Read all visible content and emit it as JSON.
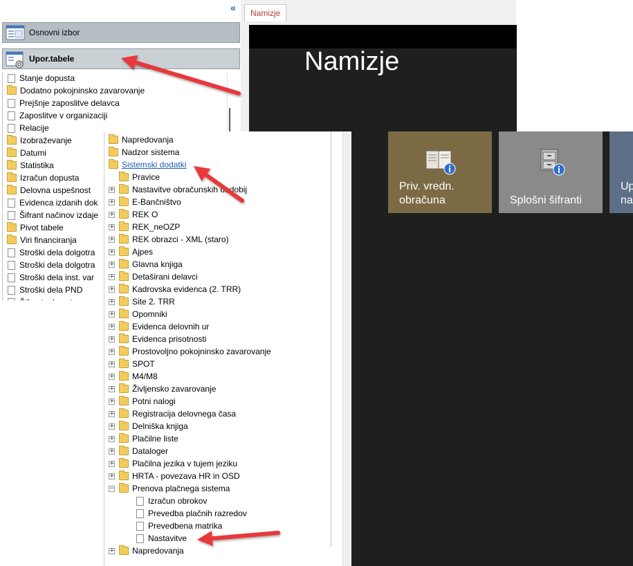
{
  "sidebar": {
    "collapse_glyph": "«",
    "panel_main": "Osnovni izbor",
    "panel_tables": "Upor.tabele",
    "items": [
      {
        "label": "Stanje dopusta",
        "icon": "document-icon"
      },
      {
        "label": "Dodatno pokojninsko zavarovanje",
        "icon": "folder-icon"
      },
      {
        "label": "Prejšnje zaposlitve delavca",
        "icon": "document-icon"
      },
      {
        "label": "Zaposlitve v organizaciji",
        "icon": "document-icon"
      },
      {
        "label": "Relacije",
        "icon": "document-icon"
      },
      {
        "label": "Izobraževanje",
        "icon": "folder-icon"
      },
      {
        "label": "Datumi",
        "icon": "folder-icon"
      },
      {
        "label": "Statistika",
        "icon": "folder-icon"
      },
      {
        "label": "Izračun dopusta",
        "icon": "folder-icon"
      },
      {
        "label": "Delovna uspešnost",
        "icon": "folder-icon"
      },
      {
        "label": "Evidenca izdanih dok",
        "icon": "document-icon"
      },
      {
        "label": "Šifrant načinov izdaje",
        "icon": "document-icon"
      },
      {
        "label": "Pivot tabele",
        "icon": "folder-icon"
      },
      {
        "label": "Viri financiranja",
        "icon": "folder-icon"
      },
      {
        "label": "Stroški dela dolgotra",
        "icon": "document-icon"
      },
      {
        "label": "Stroški dela dolgotra",
        "icon": "document-icon"
      },
      {
        "label": "Stroški dela inst. var",
        "icon": "document-icon"
      },
      {
        "label": "Stroški dela PND",
        "icon": "document-icon"
      },
      {
        "label": "Šifrant zdravstv",
        "icon": "document-icon"
      }
    ]
  },
  "desktop": {
    "tab_label": "Namizje",
    "title": "Namizje",
    "tiles": [
      {
        "label_line1": "Priv. vredn.",
        "label_line2": "obračuna",
        "color": "#7b6a43",
        "icon": "book-info-icon"
      },
      {
        "label_line1": "Splošni šifranti",
        "label_line2": "",
        "color": "#8a8a8a",
        "icon": "cabinet-info-icon"
      },
      {
        "label_line1": "Up",
        "label_line2": "na",
        "color": "#5d6f86",
        "icon": ""
      }
    ]
  },
  "tree": {
    "rows": [
      {
        "label": "Napredovanja",
        "type": "folder",
        "expander": "",
        "level": 0,
        "style": "normal"
      },
      {
        "label": "Nadzor sistema",
        "type": "folder",
        "expander": "",
        "level": 0,
        "style": "normal"
      },
      {
        "label": "Sistemski dodatki",
        "type": "folder",
        "expander": "",
        "level": 0,
        "style": "link"
      },
      {
        "label": "Pravice",
        "type": "folder",
        "expander": "",
        "level": 1,
        "style": "normal"
      },
      {
        "label": "Nastavitve obračunskih obdobij",
        "type": "folder",
        "expander": "+",
        "level": 1,
        "style": "normal"
      },
      {
        "label": "E-Bančništvo",
        "type": "folder",
        "expander": "+",
        "level": 1,
        "style": "normal"
      },
      {
        "label": "REK O",
        "type": "folder",
        "expander": "+",
        "level": 1,
        "style": "normal"
      },
      {
        "label": "REK_neOZP",
        "type": "folder",
        "expander": "+",
        "level": 1,
        "style": "normal"
      },
      {
        "label": "REK obrazci - XML (staro)",
        "type": "folder",
        "expander": "+",
        "level": 1,
        "style": "normal"
      },
      {
        "label": "Ajpes",
        "type": "folder",
        "expander": "+",
        "level": 1,
        "style": "normal"
      },
      {
        "label": "Glavna knjiga",
        "type": "folder",
        "expander": "+",
        "level": 1,
        "style": "normal"
      },
      {
        "label": "Detaširani delavci",
        "type": "folder",
        "expander": "+",
        "level": 1,
        "style": "normal"
      },
      {
        "label": "Kadrovska evidenca (2. TRR)",
        "type": "folder",
        "expander": "+",
        "level": 1,
        "style": "normal"
      },
      {
        "label": "Site 2. TRR",
        "type": "folder",
        "expander": "+",
        "level": 1,
        "style": "normal"
      },
      {
        "label": "Opomniki",
        "type": "folder",
        "expander": "+",
        "level": 1,
        "style": "normal"
      },
      {
        "label": "Evidenca delovnih ur",
        "type": "folder",
        "expander": "+",
        "level": 1,
        "style": "normal"
      },
      {
        "label": "Evidenca prisotnosti",
        "type": "folder",
        "expander": "+",
        "level": 1,
        "style": "normal"
      },
      {
        "label": "Prostovoljno pokojninsko zavarovanje",
        "type": "folder",
        "expander": "+",
        "level": 1,
        "style": "normal"
      },
      {
        "label": "SPOT",
        "type": "folder",
        "expander": "+",
        "level": 1,
        "style": "normal"
      },
      {
        "label": "M4/M8",
        "type": "folder",
        "expander": "+",
        "level": 1,
        "style": "normal"
      },
      {
        "label": "Življensko zavarovanje",
        "type": "folder",
        "expander": "+",
        "level": 1,
        "style": "normal"
      },
      {
        "label": "Potni nalogi",
        "type": "folder",
        "expander": "+",
        "level": 1,
        "style": "normal"
      },
      {
        "label": "Registracija delovnega časa",
        "type": "folder",
        "expander": "+",
        "level": 1,
        "style": "normal"
      },
      {
        "label": "Delniška knjiga",
        "type": "folder",
        "expander": "+",
        "level": 1,
        "style": "normal"
      },
      {
        "label": "Plačilne liste",
        "type": "folder",
        "expander": "+",
        "level": 1,
        "style": "normal"
      },
      {
        "label": "Dataloger",
        "type": "folder",
        "expander": "+",
        "level": 1,
        "style": "normal"
      },
      {
        "label": "Plačilna jezika v tujem jeziku",
        "type": "folder",
        "expander": "+",
        "level": 1,
        "style": "normal"
      },
      {
        "label": "HRTA - povezava HR in OSD",
        "type": "folder",
        "expander": "+",
        "level": 1,
        "style": "normal"
      },
      {
        "label": "Prenova plačnega sistema",
        "type": "folder",
        "expander": "−",
        "level": 1,
        "style": "normal"
      },
      {
        "label": "Izračun obrokov",
        "type": "document",
        "expander": "",
        "level": 2,
        "style": "normal"
      },
      {
        "label": "Prevedba plačnih razredov",
        "type": "document",
        "expander": "",
        "level": 2,
        "style": "normal"
      },
      {
        "label": "Prevedbena matrika",
        "type": "document",
        "expander": "",
        "level": 2,
        "style": "normal"
      },
      {
        "label": "Nastavitve",
        "type": "document",
        "expander": "",
        "level": 2,
        "style": "normal"
      },
      {
        "label": "Napredovanja",
        "type": "folder",
        "expander": "+",
        "level": 1,
        "style": "normal"
      }
    ]
  },
  "annotations": {
    "arrow_color": "#e8383a"
  }
}
